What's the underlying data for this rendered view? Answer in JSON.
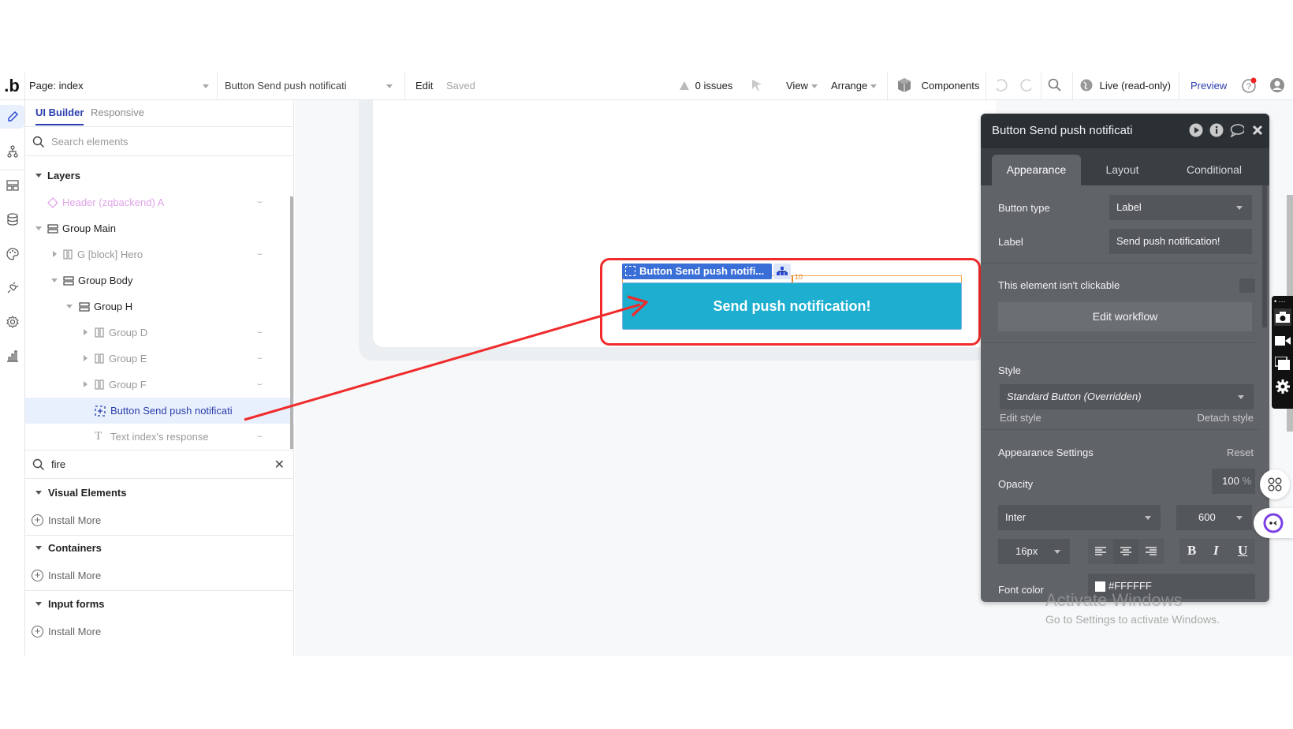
{
  "topbar": {
    "logo": ".b",
    "page_selector": "Page: index",
    "element_selector": "Button Send push notificati",
    "edit_label": "Edit",
    "saved_label": "Saved",
    "issues_label": "0 issues",
    "view_label": "View",
    "arrange_label": "Arrange",
    "components_label": "Components",
    "live_label": "Live (read-only)",
    "preview_label": "Preview"
  },
  "rail": {
    "items": [
      "design-pencil",
      "workflow",
      "data-layout",
      "database",
      "styles-palette",
      "plugins",
      "settings",
      "logs-chart"
    ]
  },
  "sidebar": {
    "tabs": [
      "UI Builder",
      "Responsive"
    ],
    "search_placeholder": "Search elements",
    "layers_header": "Layers",
    "layers": [
      {
        "label": "Header (zqbackend) A",
        "depth": 0,
        "type": "reusable",
        "hidden": true
      },
      {
        "label": "Group Main",
        "depth": 0,
        "type": "group",
        "expanded": true
      },
      {
        "label": "G [block] Hero",
        "depth": 1,
        "type": "row-group",
        "hidden": true
      },
      {
        "label": "Group Body",
        "depth": 1,
        "type": "group",
        "expanded": true
      },
      {
        "label": "Group H",
        "depth": 2,
        "type": "group",
        "expanded": true
      },
      {
        "label": "Group D",
        "depth": 3,
        "type": "row-group",
        "hidden": true
      },
      {
        "label": "Group E",
        "depth": 3,
        "type": "row-group",
        "hidden": true
      },
      {
        "label": "Group F",
        "depth": 3,
        "type": "row-group",
        "hidden": true
      },
      {
        "label": "Button Send push notificati",
        "depth": 3,
        "type": "button",
        "selected": true
      },
      {
        "label": "Text index's response",
        "depth": 3,
        "type": "text",
        "hidden": true
      }
    ],
    "element_search_value": "fire",
    "sections": [
      {
        "title": "Visual Elements",
        "action": "Install More"
      },
      {
        "title": "Containers",
        "action": "Install More"
      },
      {
        "title": "Input forms",
        "action": "Install More"
      }
    ]
  },
  "canvas": {
    "element_tag": "Button Send push notifi...",
    "guide_value": "10",
    "button_text": "Send push notification!",
    "button_color": "#1daed0",
    "highlight_color": "#ef2b2b"
  },
  "panel": {
    "title": "Button Send push notificati",
    "tabs": [
      "Appearance",
      "Layout",
      "Conditional"
    ],
    "button_type_label": "Button type",
    "button_type_value": "Label",
    "label_label": "Label",
    "label_value": "Send push notification!",
    "not_clickable_label": "This element isn't clickable",
    "edit_workflow": "Edit workflow",
    "style_label": "Style",
    "style_value": "Standard Button (Overridden)",
    "edit_style": "Edit style",
    "detach_style": "Detach style",
    "appearance_settings": "Appearance Settings",
    "reset": "Reset",
    "opacity_label": "Opacity",
    "opacity_value": "100",
    "opacity_unit": "%",
    "font_family": "Inter",
    "font_weight": "600",
    "font_size": "16px",
    "bold": "B",
    "italic": "I",
    "underline": "U",
    "font_color_label": "Font color",
    "font_color_value": "#FFFFFF"
  },
  "watermark": {
    "line1": "Activate Windows",
    "line2": "Go to Settings to activate Windows."
  }
}
